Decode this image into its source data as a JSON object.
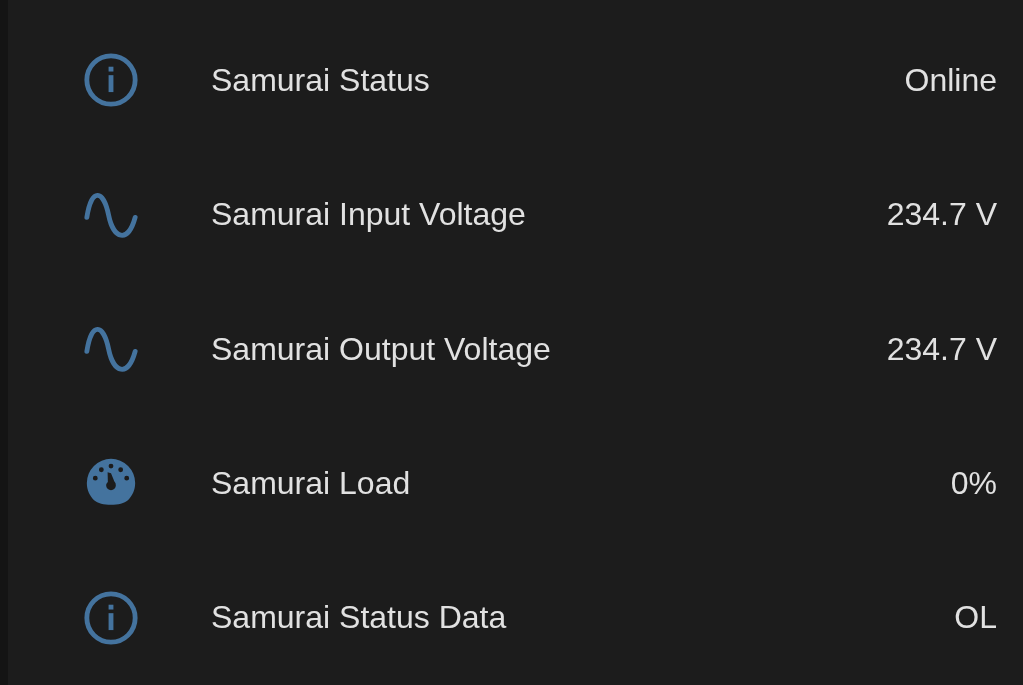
{
  "entities": [
    {
      "kind": "info",
      "name": "Samurai Status",
      "state": "Online"
    },
    {
      "kind": "sine",
      "name": "Samurai Input Voltage",
      "state": "234.7 V"
    },
    {
      "kind": "sine",
      "name": "Samurai Output Voltage",
      "state": "234.7 V"
    },
    {
      "kind": "gauge",
      "name": "Samurai Load",
      "state": "0%"
    },
    {
      "kind": "info",
      "name": "Samurai Status Data",
      "state": "OL"
    }
  ]
}
